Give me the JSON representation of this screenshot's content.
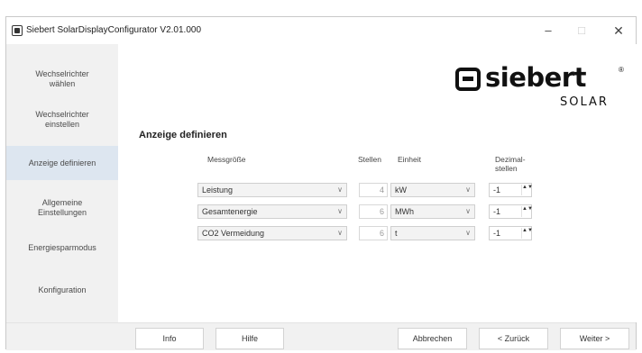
{
  "window": {
    "title": "Siebert SolarDisplayConfigurator V2.01.000",
    "minimize_glyph": "–",
    "maximize_glyph": "□",
    "close_glyph": "✕"
  },
  "sidebar": {
    "items": [
      {
        "label": "Wechselrichter\nwählen",
        "active": false
      },
      {
        "label": "Wechselrichter\neinstellen",
        "active": false
      },
      {
        "label": "Anzeige definieren",
        "active": true
      },
      {
        "label": "Allgemeine\nEinstellungen",
        "active": false
      },
      {
        "label": "Energiesparmodus",
        "active": false
      },
      {
        "label": "Konfiguration",
        "active": false
      }
    ]
  },
  "logo": {
    "brand": "siebert",
    "registered": "®",
    "sub": "SOLAR"
  },
  "main": {
    "section_title": "Anzeige definieren",
    "columns": {
      "messgroesse": "Messgröße",
      "stellen": "Stellen",
      "einheit": "Einheit",
      "dezimalstellen": "Dezimal-\nstellen"
    },
    "rows": [
      {
        "messgroesse": "Leistung",
        "stellen": "4",
        "einheit": "kW",
        "dezimal": "-1"
      },
      {
        "messgroesse": "Gesamtenergie",
        "stellen": "6",
        "einheit": "MWh",
        "dezimal": "-1"
      },
      {
        "messgroesse": "CO2 Vermeidung",
        "stellen": "6",
        "einheit": "t",
        "dezimal": "-1"
      }
    ]
  },
  "buttons": {
    "info": "Info",
    "hilfe": "Hilfe",
    "abbrechen": "Abbrechen",
    "zurueck": "< Zurück",
    "weiter": "Weiter >"
  },
  "icons": {
    "chevron": "∨",
    "spin": "▲▼"
  }
}
